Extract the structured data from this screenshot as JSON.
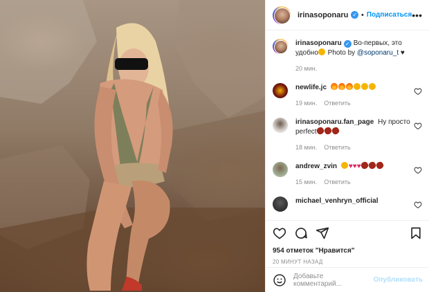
{
  "header": {
    "username": "irinasoponaru",
    "separator": "•",
    "follow_label": "Подписаться",
    "more_icon": "more-horizontal-icon"
  },
  "caption": {
    "username": "irinasoponaru",
    "text": "Во-первых, это удобно",
    "photo_by": " Photo by ",
    "mention": "@soponaru_t",
    "time": "20 мин."
  },
  "comments": [
    {
      "username": "newlife.jc",
      "text": "",
      "time": "19 мин.",
      "reply": "Ответить",
      "avatar_color": "#5a1a1a",
      "emoji": [
        "fire",
        "fire",
        "fire",
        "face",
        "face",
        "face"
      ]
    },
    {
      "username": "irinasoponaru.fan_page",
      "text": "Ну просто perfect",
      "time": "18 мин.",
      "reply": "Ответить",
      "avatar_color": "#c9c3bd",
      "emoji": [
        "ball",
        "ball",
        "ball"
      ]
    },
    {
      "username": "andrew_zvin",
      "text": "",
      "time": "15 мин.",
      "reply": "Ответить",
      "avatar_color": "#8a9a7b",
      "emoji": [
        "face",
        "heart",
        "heart",
        "heart",
        "ball",
        "ball",
        "ball"
      ]
    },
    {
      "username": "michael_venhryn_official",
      "text": "",
      "time": "",
      "reply": "",
      "avatar_color": "#2f2f2f",
      "emoji": []
    }
  ],
  "actions": {
    "likes": "954 отметок \"Нравится\"",
    "posted": "20 МИНУТ НАЗАД"
  },
  "add_comment": {
    "placeholder": "Добавьте комментарий...",
    "publish_label": "Опубликовать"
  },
  "colors": {
    "link": "#0095f6",
    "verified": "#3897f0",
    "muted": "#8e8e8e"
  }
}
